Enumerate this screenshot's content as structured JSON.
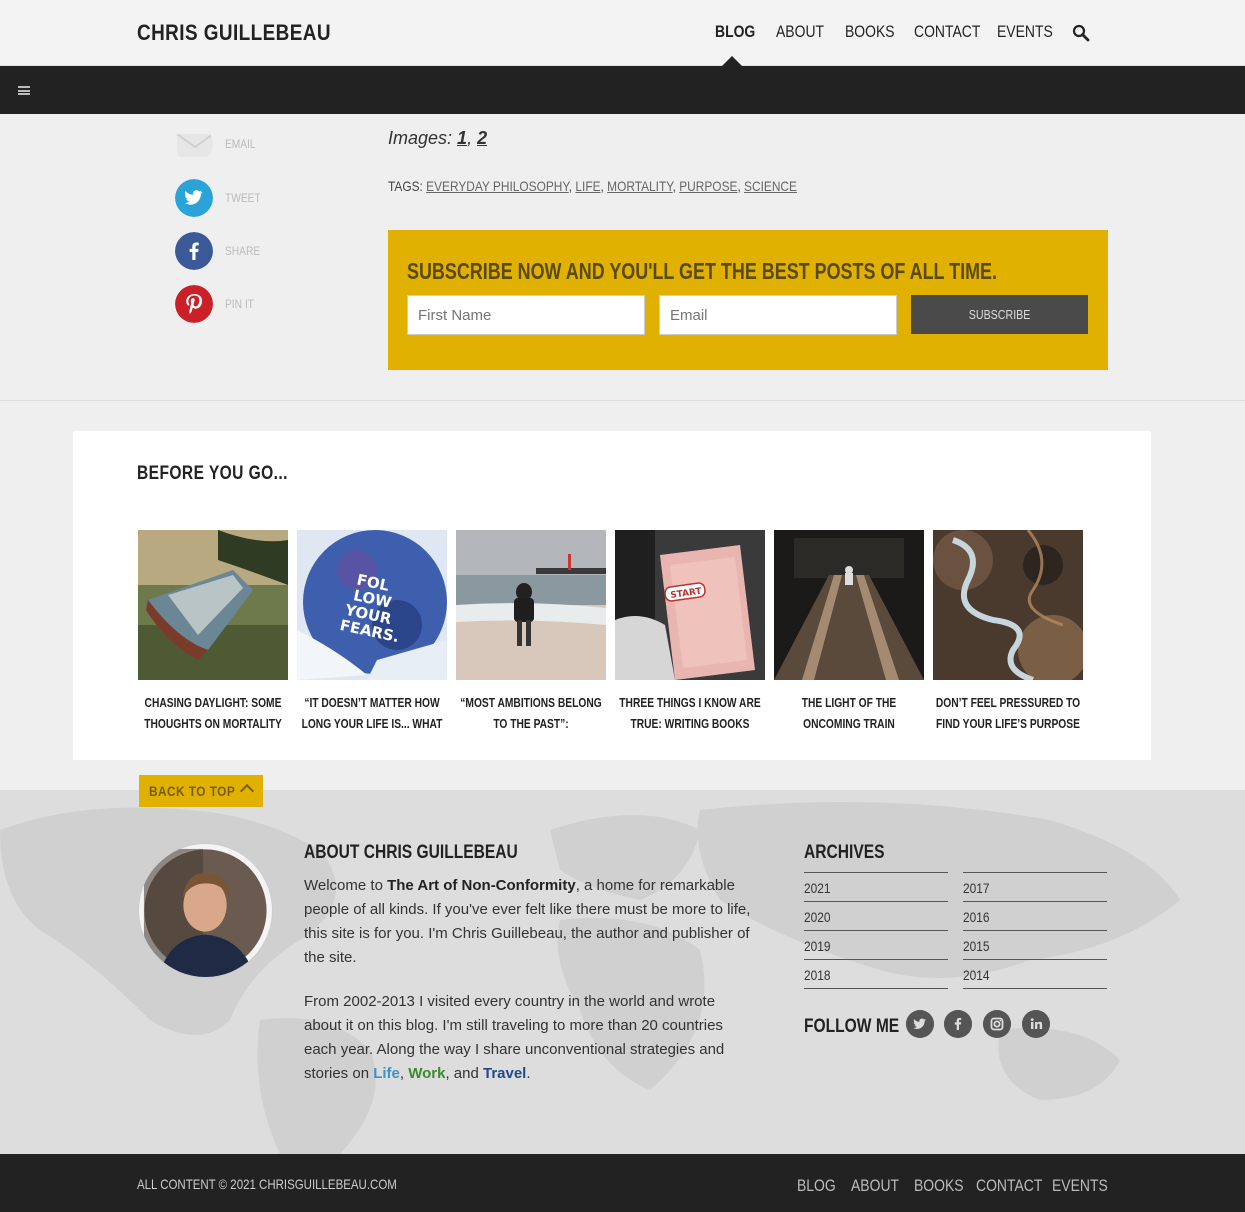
{
  "header": {
    "logo": "CHRIS GUILLEBEAU",
    "nav": [
      "BLOG",
      "ABOUT",
      "BOOKS",
      "CONTACT",
      "EVENTS"
    ],
    "active_nav": "BLOG"
  },
  "share": [
    {
      "label": "EMAIL",
      "icon": "email-icon",
      "color": "#e8e8e8"
    },
    {
      "label": "TWEET",
      "icon": "twitter-icon",
      "color": "#2aa3d8"
    },
    {
      "label": "SHARE",
      "icon": "facebook-icon",
      "color": "#3b5998"
    },
    {
      "label": "PIN IT",
      "icon": "pinterest-icon",
      "color": "#cb2027"
    }
  ],
  "post": {
    "images_label": "Images:",
    "image_links": [
      "1",
      "2"
    ],
    "tags_label": "TAGS:",
    "tags": [
      "EVERYDAY PHILOSOPHY",
      "LIFE",
      "MORTALITY",
      "PURPOSE",
      "SCIENCE"
    ]
  },
  "subscribe": {
    "heading": "SUBSCRIBE NOW AND YOU'LL GET THE BEST POSTS OF ALL TIME.",
    "first_name_placeholder": "First Name",
    "email_placeholder": "Email",
    "button": "SUBSCRIBE",
    "bg_color": "#e0b100"
  },
  "before_you_go": {
    "title": "BEFORE YOU GO...",
    "posts": [
      {
        "title": "CHASING DAYLIGHT: SOME THOUGHTS ON MORTALITY"
      },
      {
        "title": "“IT DOESN’T MATTER HOW LONG YOUR LIFE IS... WHAT MATTERS"
      },
      {
        "title": "“MOST AMBITIONS BELONG TO THE PAST”: REFLECTIONS ON A"
      },
      {
        "title": "THREE THINGS I KNOW ARE TRUE: WRITING BOOKS"
      },
      {
        "title": "THE LIGHT OF THE ONCOMING TRAIN STRENGTHENS THE MIND"
      },
      {
        "title": "DON’T FEEL PRESSURED TO FIND YOUR LIFE’S PURPOSE AT AGE"
      }
    ],
    "thumb_text": "FOL LOW YOUR FEARS."
  },
  "back_to_top": "BACK TO TOP",
  "about": {
    "title": "ABOUT CHRIS GUILLEBEAU",
    "p1_pre": "Welcome to ",
    "p1_bold": "The Art of Non-Conformity",
    "p1_post": ", a home for remarkable people of all kinds. If you've ever felt like there must be more to life, this site is for you. I'm Chris Guillebeau, the author and publisher of the site.",
    "p2_pre": "From 2002-2013 I visited every country in the world and wrote about it on this blog. I'm still traveling to more than 20 countries each year. Along the way I share unconventional strategies and stories on ",
    "life": "Life",
    "comma": ", ",
    "work": "Work",
    "and": ", and ",
    "travel": "Travel",
    "period": "."
  },
  "archives": {
    "title": "ARCHIVES",
    "left": [
      "2021",
      "2020",
      "2019",
      "2018"
    ],
    "right": [
      "2017",
      "2016",
      "2015",
      "2014"
    ]
  },
  "follow": {
    "title": "FOLLOW ME",
    "icons": [
      "twitter-icon",
      "facebook-icon",
      "instagram-icon",
      "linkedin-icon"
    ]
  },
  "footer": {
    "copyright": "ALL CONTENT © 2021 CHRISGUILLEBEAU.COM",
    "nav": [
      "BLOG",
      "ABOUT",
      "BOOKS",
      "CONTACT",
      "EVENTS"
    ]
  }
}
